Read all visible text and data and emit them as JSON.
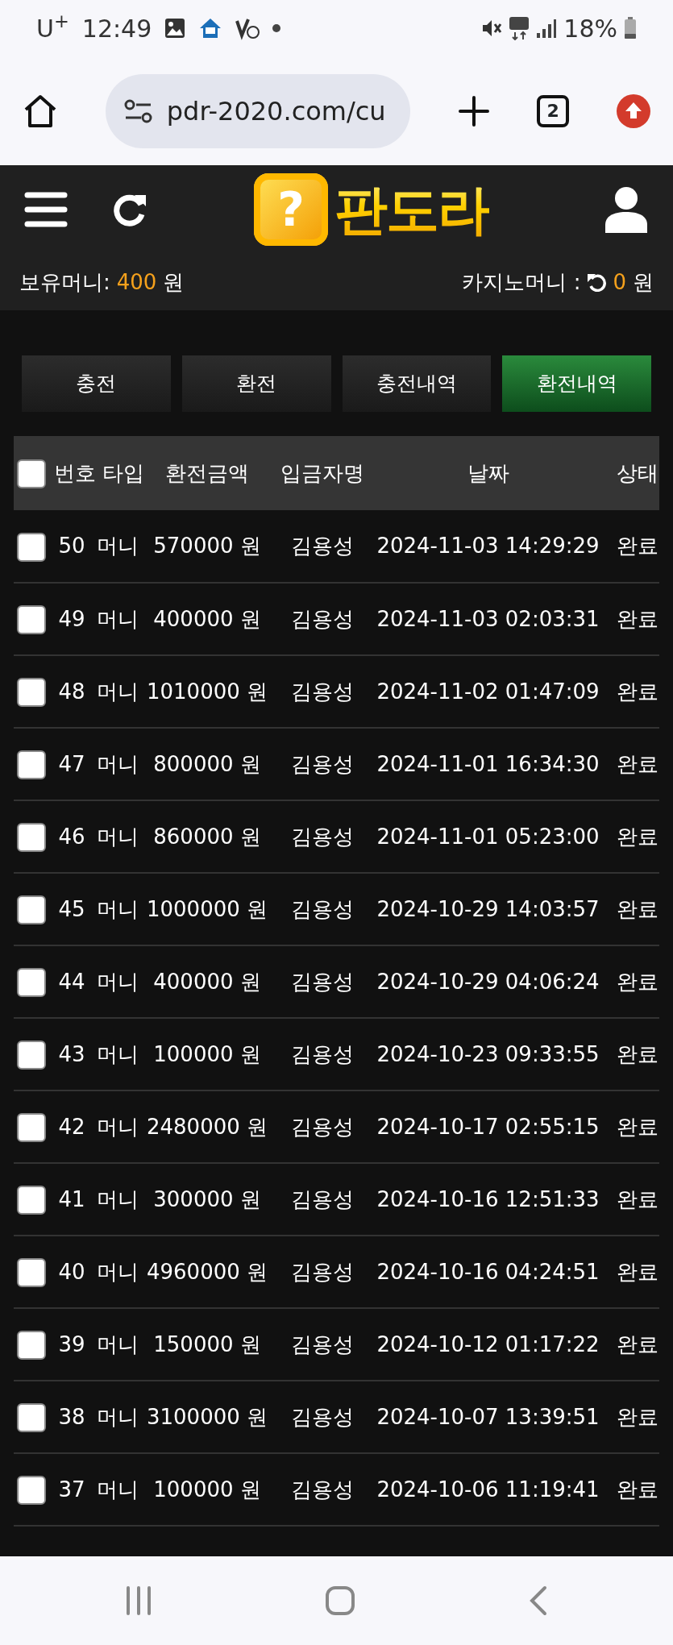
{
  "status_bar": {
    "carrier": "U$^{+}$",
    "time": "12:49",
    "battery": "18%"
  },
  "browser": {
    "url": "pdr-2020.com/cu",
    "tab_count": "2"
  },
  "header": {
    "logo": {
      "badge": "?",
      "name": "판도라"
    }
  },
  "balance": {
    "money_label": "보유머니:",
    "money_value": "400",
    "money_unit": "원",
    "casino_label": "카지노머니 :",
    "casino_value": "0",
    "casino_unit": "원"
  },
  "tabs": [
    {
      "label": "충전",
      "selected": false
    },
    {
      "label": "환전",
      "selected": false
    },
    {
      "label": "충전내역",
      "selected": false
    },
    {
      "label": "환전내역",
      "selected": true
    }
  ],
  "table": {
    "select_all_checked": false,
    "columns": [
      "번호 타입",
      "환전금액",
      "입금자명",
      "날짜",
      "상태"
    ],
    "rows": [
      {
        "checked": false,
        "number": "50",
        "type": "머니",
        "amount": "570000 원",
        "name": "김용성",
        "date": "2024-11-03 14:29:29",
        "status": "완료"
      },
      {
        "checked": false,
        "number": "49",
        "type": "머니",
        "amount": "400000 원",
        "name": "김용성",
        "date": "2024-11-03 02:03:31",
        "status": "완료"
      },
      {
        "checked": false,
        "number": "48",
        "type": "머니",
        "amount": "1010000 원",
        "name": "김용성",
        "date": "2024-11-02 01:47:09",
        "status": "완료"
      },
      {
        "checked": false,
        "number": "47",
        "type": "머니",
        "amount": "800000 원",
        "name": "김용성",
        "date": "2024-11-01 16:34:30",
        "status": "완료"
      },
      {
        "checked": false,
        "number": "46",
        "type": "머니",
        "amount": "860000 원",
        "name": "김용성",
        "date": "2024-11-01 05:23:00",
        "status": "완료"
      },
      {
        "checked": false,
        "number": "45",
        "type": "머니",
        "amount": "1000000 원",
        "name": "김용성",
        "date": "2024-10-29 14:03:57",
        "status": "완료"
      },
      {
        "checked": false,
        "number": "44",
        "type": "머니",
        "amount": "400000 원",
        "name": "김용성",
        "date": "2024-10-29 04:06:24",
        "status": "완료"
      },
      {
        "checked": false,
        "number": "43",
        "type": "머니",
        "amount": "100000 원",
        "name": "김용성",
        "date": "2024-10-23 09:33:55",
        "status": "완료"
      },
      {
        "checked": false,
        "number": "42",
        "type": "머니",
        "amount": "2480000 원",
        "name": "김용성",
        "date": "2024-10-17 02:55:15",
        "status": "완료"
      },
      {
        "checked": false,
        "number": "41",
        "type": "머니",
        "amount": "300000 원",
        "name": "김용성",
        "date": "2024-10-16 12:51:33",
        "status": "완료"
      },
      {
        "checked": false,
        "number": "40",
        "type": "머니",
        "amount": "4960000 원",
        "name": "김용성",
        "date": "2024-10-16 04:24:51",
        "status": "완료"
      },
      {
        "checked": false,
        "number": "39",
        "type": "머니",
        "amount": "150000 원",
        "name": "김용성",
        "date": "2024-10-12 01:17:22",
        "status": "완료"
      },
      {
        "checked": false,
        "number": "38",
        "type": "머니",
        "amount": "3100000 원",
        "name": "김용성",
        "date": "2024-10-07 13:39:51",
        "status": "완료"
      },
      {
        "checked": false,
        "number": "37",
        "type": "머니",
        "amount": "100000 원",
        "name": "김용성",
        "date": "2024-10-06 11:19:41",
        "status": "완료"
      }
    ]
  }
}
